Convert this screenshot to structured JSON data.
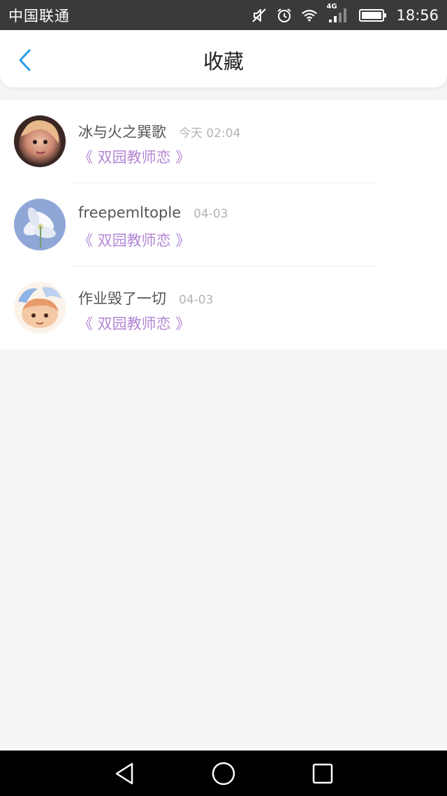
{
  "status_bar": {
    "carrier": "中国联通",
    "network": "4G",
    "time": "18:56"
  },
  "header": {
    "title": "收藏"
  },
  "favorites": [
    {
      "name": "冰与火之巽歌",
      "time": "今天 02:04",
      "work_title": "《 双园教师恋 》"
    },
    {
      "name": "freepemltople",
      "time": "04-03",
      "work_title": "《 双园教师恋 》"
    },
    {
      "name": "作业毁了一切",
      "time": "04-03",
      "work_title": "《 双园教师恋 》"
    }
  ],
  "colors": {
    "status_bar_bg": "#3a3a3a",
    "accent_blue": "#2a9be8",
    "link_purple": "#b386d4",
    "page_bg": "#f5f5f5"
  },
  "icons": [
    "mute-icon",
    "alarm-icon",
    "wifi-icon",
    "signal-icon",
    "battery-icon",
    "back-arrow-icon",
    "nav-back-icon",
    "nav-home-icon",
    "nav-recents-icon"
  ]
}
